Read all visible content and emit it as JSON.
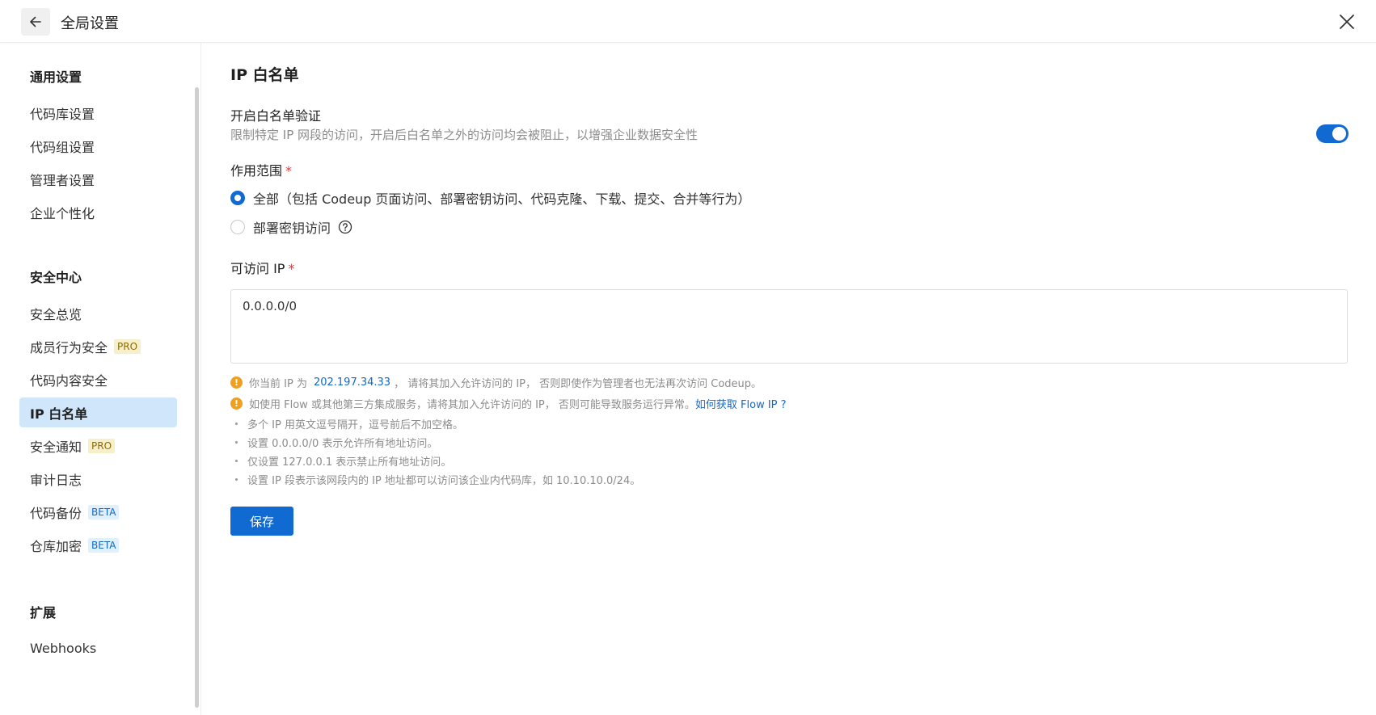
{
  "header": {
    "title": "全局设置",
    "back_icon": "arrow-left-icon",
    "close_icon": "close-icon"
  },
  "sidebar": {
    "groups": [
      {
        "title": "通用设置",
        "items": [
          {
            "label": "代码库设置"
          },
          {
            "label": "代码组设置"
          },
          {
            "label": "管理者设置"
          },
          {
            "label": "企业个性化"
          }
        ]
      },
      {
        "title": "安全中心",
        "items": [
          {
            "label": "安全总览"
          },
          {
            "label": "成员行为安全",
            "tag": "PRO"
          },
          {
            "label": "代码内容安全"
          },
          {
            "label": "IP 白名单",
            "active": true
          },
          {
            "label": "安全通知",
            "tag": "PRO"
          },
          {
            "label": "审计日志"
          },
          {
            "label": "代码备份",
            "tag": "BETA"
          },
          {
            "label": "仓库加密",
            "tag": "BETA"
          }
        ]
      },
      {
        "title": "扩展",
        "items": [
          {
            "label": "Webhooks"
          }
        ]
      }
    ]
  },
  "main": {
    "title": "IP 白名单",
    "whitelist_toggle": {
      "label": "开启白名单验证",
      "description": "限制特定 IP 网段的访问，开启后白名单之外的访问均会被阻止，以增强企业数据安全性",
      "enabled": true
    },
    "scope": {
      "label": "作用范围",
      "required_mark": "*",
      "options": [
        {
          "label": "全部（包括 Codeup 页面访问、部署密钥访问、代码克隆、下载、提交、合并等行为）",
          "checked": true
        },
        {
          "label": "部署密钥访问",
          "checked": false
        }
      ],
      "help_icon": "question-circle-icon"
    },
    "ip_field": {
      "label": "可访问 IP",
      "required_mark": "*",
      "value": "0.0.0.0/0"
    },
    "warnings": {
      "current_ip_prefix": "你当前 IP 为",
      "current_ip": "202.197.34.33",
      "current_ip_suffix": "， 请将其加入允许访问的 IP， 否则即使作为管理者也无法再次访问 Codeup。",
      "flow_text": "如使用 Flow 或其他第三方集成服务，请将其加入允许访问的 IP， 否则可能导致服务运行异常。",
      "flow_link": "如何获取 Flow IP ?"
    },
    "tips": [
      "多个 IP 用英文逗号隔开，逗号前后不加空格。",
      "设置 0.0.0.0/0 表示允许所有地址访问。",
      "仅设置 127.0.0.1 表示禁止所有地址访问。",
      "设置 IP 段表示该网段内的 IP 地址都可以访问该企业内代码库，如 10.10.10.0/24。"
    ],
    "save_label": "保存"
  },
  "colors": {
    "primary": "#1169d2",
    "active_nav_bg": "#cfe6fb",
    "warning": "#f0a020",
    "required": "#e23d3d"
  }
}
